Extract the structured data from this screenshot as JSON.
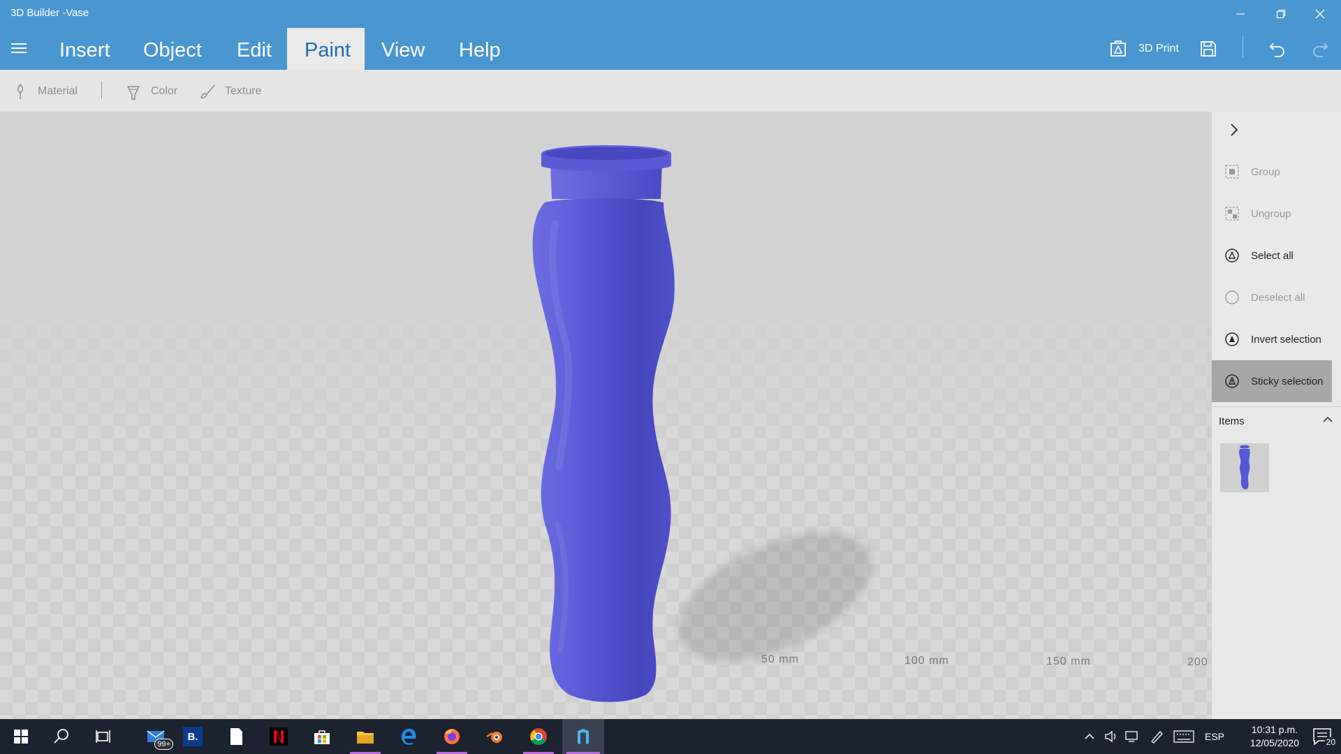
{
  "window": {
    "title": "3D Builder -Vase",
    "controls": [
      "minimize",
      "restore",
      "close"
    ]
  },
  "menu": {
    "tabs": [
      {
        "label": "Insert",
        "active": false
      },
      {
        "label": "Object",
        "active": false
      },
      {
        "label": "Edit",
        "active": false
      },
      {
        "label": "Paint",
        "active": true
      },
      {
        "label": "View",
        "active": false
      },
      {
        "label": "Help",
        "active": false
      }
    ],
    "print_label": "3D Print",
    "icons": {
      "print": "3d-print-icon",
      "save": "save-icon",
      "undo": "undo-icon",
      "redo": "redo-icon"
    }
  },
  "paint_toolbar": {
    "material_label": "Material",
    "color_label": "Color",
    "texture_label": "Texture"
  },
  "viewport": {
    "object_name": "Vase",
    "object_color": "#5656d6",
    "ruler_labels": [
      "50 mm",
      "100 mm",
      "150 mm",
      "200"
    ]
  },
  "side_panel": {
    "actions": [
      {
        "label": "Group",
        "enabled": false,
        "selected": false,
        "icon": "group-icon"
      },
      {
        "label": "Ungroup",
        "enabled": false,
        "selected": false,
        "icon": "ungroup-icon"
      },
      {
        "label": "Select all",
        "enabled": true,
        "selected": false,
        "icon": "select-all-icon"
      },
      {
        "label": "Deselect all",
        "enabled": false,
        "selected": false,
        "icon": "deselect-all-icon"
      },
      {
        "label": "Invert selection",
        "enabled": true,
        "selected": false,
        "icon": "invert-selection-icon"
      },
      {
        "label": "Sticky selection",
        "enabled": true,
        "selected": true,
        "icon": "sticky-selection-icon"
      }
    ],
    "items_label": "Items"
  },
  "taskbar": {
    "mail_badge": "99+",
    "booking_letter": "B.",
    "language": "ESP",
    "time": "10:31 p.m.",
    "date": "12/05/2020",
    "notification_count": "20"
  },
  "colors": {
    "accent": "#4a96d1",
    "active_tab_text": "#1e6fb4",
    "taskbar": "#1c2230"
  }
}
